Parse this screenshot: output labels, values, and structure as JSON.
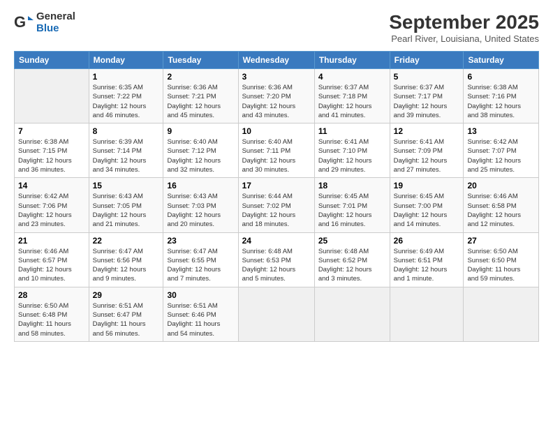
{
  "logo": {
    "general": "General",
    "blue": "Blue"
  },
  "title": "September 2025",
  "location": "Pearl River, Louisiana, United States",
  "headers": [
    "Sunday",
    "Monday",
    "Tuesday",
    "Wednesday",
    "Thursday",
    "Friday",
    "Saturday"
  ],
  "weeks": [
    [
      {
        "day": "",
        "info": ""
      },
      {
        "day": "1",
        "info": "Sunrise: 6:35 AM\nSunset: 7:22 PM\nDaylight: 12 hours\nand 46 minutes."
      },
      {
        "day": "2",
        "info": "Sunrise: 6:36 AM\nSunset: 7:21 PM\nDaylight: 12 hours\nand 45 minutes."
      },
      {
        "day": "3",
        "info": "Sunrise: 6:36 AM\nSunset: 7:20 PM\nDaylight: 12 hours\nand 43 minutes."
      },
      {
        "day": "4",
        "info": "Sunrise: 6:37 AM\nSunset: 7:18 PM\nDaylight: 12 hours\nand 41 minutes."
      },
      {
        "day": "5",
        "info": "Sunrise: 6:37 AM\nSunset: 7:17 PM\nDaylight: 12 hours\nand 39 minutes."
      },
      {
        "day": "6",
        "info": "Sunrise: 6:38 AM\nSunset: 7:16 PM\nDaylight: 12 hours\nand 38 minutes."
      }
    ],
    [
      {
        "day": "7",
        "info": "Sunrise: 6:38 AM\nSunset: 7:15 PM\nDaylight: 12 hours\nand 36 minutes."
      },
      {
        "day": "8",
        "info": "Sunrise: 6:39 AM\nSunset: 7:14 PM\nDaylight: 12 hours\nand 34 minutes."
      },
      {
        "day": "9",
        "info": "Sunrise: 6:40 AM\nSunset: 7:12 PM\nDaylight: 12 hours\nand 32 minutes."
      },
      {
        "day": "10",
        "info": "Sunrise: 6:40 AM\nSunset: 7:11 PM\nDaylight: 12 hours\nand 30 minutes."
      },
      {
        "day": "11",
        "info": "Sunrise: 6:41 AM\nSunset: 7:10 PM\nDaylight: 12 hours\nand 29 minutes."
      },
      {
        "day": "12",
        "info": "Sunrise: 6:41 AM\nSunset: 7:09 PM\nDaylight: 12 hours\nand 27 minutes."
      },
      {
        "day": "13",
        "info": "Sunrise: 6:42 AM\nSunset: 7:07 PM\nDaylight: 12 hours\nand 25 minutes."
      }
    ],
    [
      {
        "day": "14",
        "info": "Sunrise: 6:42 AM\nSunset: 7:06 PM\nDaylight: 12 hours\nand 23 minutes."
      },
      {
        "day": "15",
        "info": "Sunrise: 6:43 AM\nSunset: 7:05 PM\nDaylight: 12 hours\nand 21 minutes."
      },
      {
        "day": "16",
        "info": "Sunrise: 6:43 AM\nSunset: 7:03 PM\nDaylight: 12 hours\nand 20 minutes."
      },
      {
        "day": "17",
        "info": "Sunrise: 6:44 AM\nSunset: 7:02 PM\nDaylight: 12 hours\nand 18 minutes."
      },
      {
        "day": "18",
        "info": "Sunrise: 6:45 AM\nSunset: 7:01 PM\nDaylight: 12 hours\nand 16 minutes."
      },
      {
        "day": "19",
        "info": "Sunrise: 6:45 AM\nSunset: 7:00 PM\nDaylight: 12 hours\nand 14 minutes."
      },
      {
        "day": "20",
        "info": "Sunrise: 6:46 AM\nSunset: 6:58 PM\nDaylight: 12 hours\nand 12 minutes."
      }
    ],
    [
      {
        "day": "21",
        "info": "Sunrise: 6:46 AM\nSunset: 6:57 PM\nDaylight: 12 hours\nand 10 minutes."
      },
      {
        "day": "22",
        "info": "Sunrise: 6:47 AM\nSunset: 6:56 PM\nDaylight: 12 hours\nand 9 minutes."
      },
      {
        "day": "23",
        "info": "Sunrise: 6:47 AM\nSunset: 6:55 PM\nDaylight: 12 hours\nand 7 minutes."
      },
      {
        "day": "24",
        "info": "Sunrise: 6:48 AM\nSunset: 6:53 PM\nDaylight: 12 hours\nand 5 minutes."
      },
      {
        "day": "25",
        "info": "Sunrise: 6:48 AM\nSunset: 6:52 PM\nDaylight: 12 hours\nand 3 minutes."
      },
      {
        "day": "26",
        "info": "Sunrise: 6:49 AM\nSunset: 6:51 PM\nDaylight: 12 hours\nand 1 minute."
      },
      {
        "day": "27",
        "info": "Sunrise: 6:50 AM\nSunset: 6:50 PM\nDaylight: 11 hours\nand 59 minutes."
      }
    ],
    [
      {
        "day": "28",
        "info": "Sunrise: 6:50 AM\nSunset: 6:48 PM\nDaylight: 11 hours\nand 58 minutes."
      },
      {
        "day": "29",
        "info": "Sunrise: 6:51 AM\nSunset: 6:47 PM\nDaylight: 11 hours\nand 56 minutes."
      },
      {
        "day": "30",
        "info": "Sunrise: 6:51 AM\nSunset: 6:46 PM\nDaylight: 11 hours\nand 54 minutes."
      },
      {
        "day": "",
        "info": ""
      },
      {
        "day": "",
        "info": ""
      },
      {
        "day": "",
        "info": ""
      },
      {
        "day": "",
        "info": ""
      }
    ]
  ]
}
